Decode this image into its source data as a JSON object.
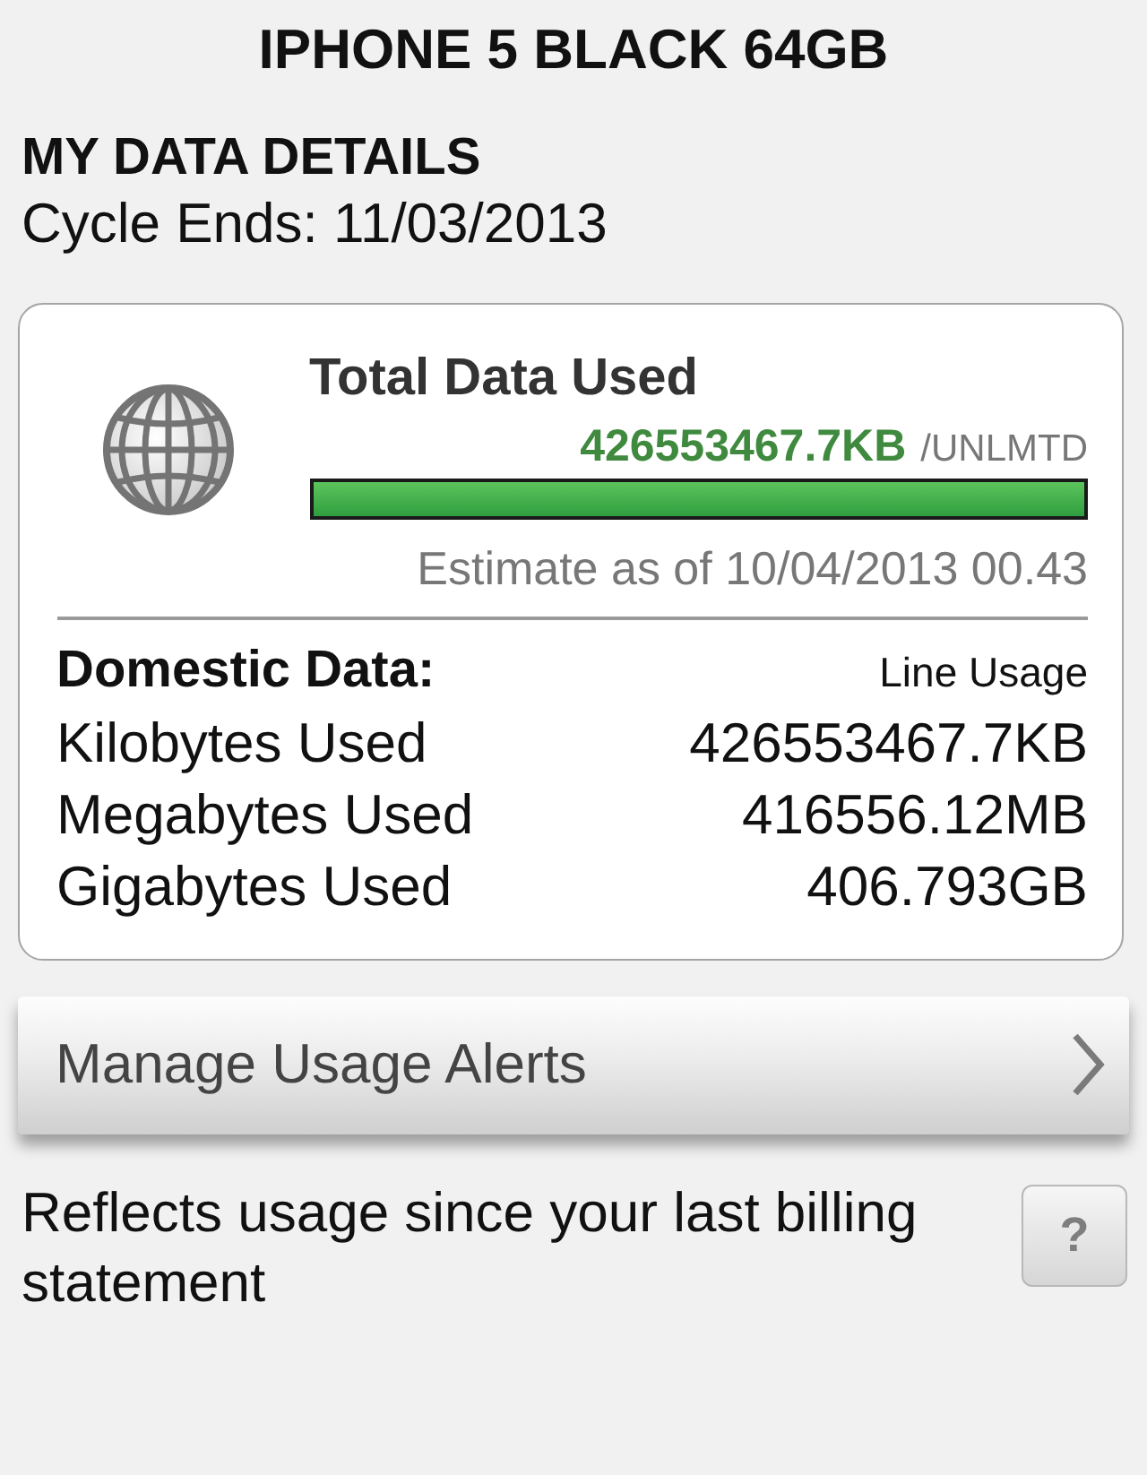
{
  "device": {
    "title": "IPHONE 5 BLACK 64GB"
  },
  "section": {
    "heading": "MY DATA DETAILS",
    "cycle": "Cycle Ends: 11/03/2013"
  },
  "total_card": {
    "title": "Total Data Used",
    "amount": "426553467.7KB",
    "limit": "/UNLMTD",
    "level": 1,
    "estimate": "Estimate as of 10/04/2013 00.43",
    "breakdown": {
      "heading": "Domestic Data:",
      "column_label": "Line Usage",
      "rows": [
        {
          "label": "Kilobytes Used",
          "value": "426553467.7KB"
        },
        {
          "label": "Megabytes Used",
          "value": "416556.12MB"
        },
        {
          "label": "Gigabytes Used",
          "value": "406.793GB"
        }
      ]
    }
  },
  "alerts_button": {
    "label": "Manage Usage Alerts"
  },
  "footnote": {
    "text": "Reflects usage since your last billing statement",
    "help": "?"
  }
}
